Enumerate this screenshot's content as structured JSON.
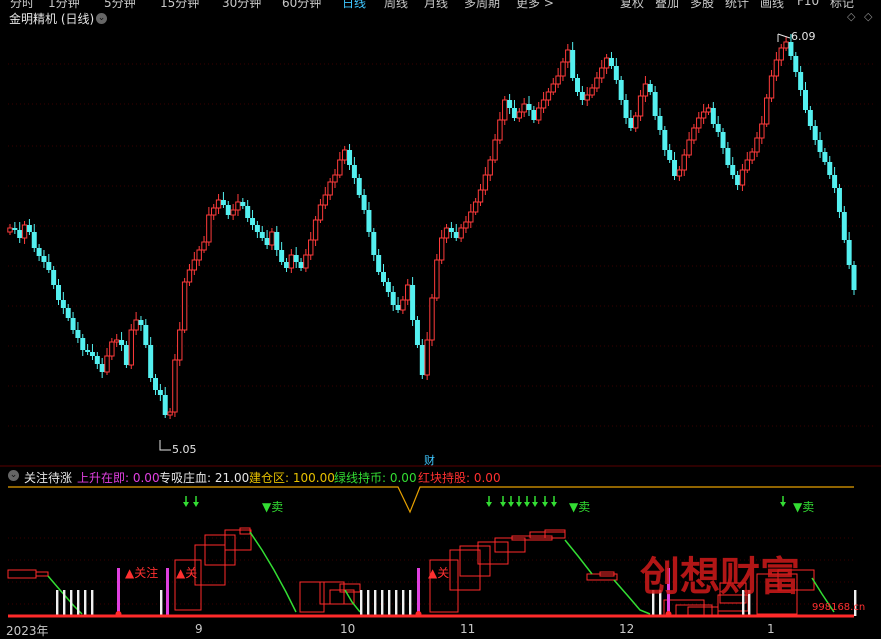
{
  "toolbar": {
    "items": [
      "分时",
      "1分钟",
      "5分钟",
      "15分钟",
      "30分钟",
      "60分钟",
      "日线",
      "周线",
      "月线",
      "多周期",
      "更多 >"
    ],
    "active": "日线",
    "right_items": [
      "复权",
      "叠加",
      "多股",
      "统计",
      "画线",
      "F10",
      "标记"
    ]
  },
  "main": {
    "title": "金明精机 (日线)",
    "high_label": "6.09",
    "low_label": "5.05",
    "event_label": "财"
  },
  "indicator": {
    "name": "关注待涨",
    "legend": [
      {
        "label": "上升在即: 0.00",
        "color": "#e040e0"
      },
      {
        "label": "专吸庄血: 21.00",
        "color": "#e6e6e6"
      },
      {
        "label": "建仓区: 100.00",
        "color": "#e6c000"
      },
      {
        "label": "绿线持币: 0.00",
        "color": "#33dd33"
      },
      {
        "label": "红块持股: 0.00",
        "color": "#ff3030"
      }
    ],
    "sell_label": "▼卖",
    "watch_label": "▲关注",
    "watch_label_short": "▲关",
    "watch_label_tiny": "▲关",
    "watermark": "创想财富",
    "watermark_url": "998168.cn"
  },
  "xaxis": {
    "labels": [
      "2023年",
      "9",
      "10",
      "11",
      "12",
      "1"
    ]
  },
  "colors": {
    "up": "#ff3b3b",
    "down": "#54f0f0",
    "grid": "#3a0000",
    "accent": "#3fc7ff"
  }
}
